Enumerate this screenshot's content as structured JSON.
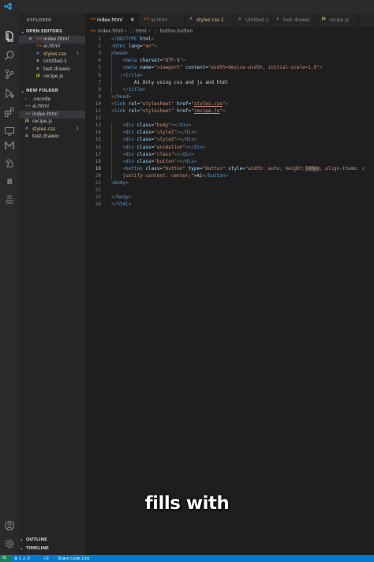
{
  "sidebar": {
    "title": "EXPLORER",
    "open_editors_label": "OPEN EDITORS",
    "open_editors": [
      {
        "name": "index.html",
        "type": "<>",
        "type_color": "#e37933",
        "color": "#cccccc",
        "close": "✕",
        "selected": true
      },
      {
        "name": "ai.html",
        "type": "<>",
        "type_color": "#e37933",
        "color": "#cccccc"
      },
      {
        "name": "styles.css",
        "type": "#",
        "type_color": "#519aba",
        "color": "#e2c08d",
        "badge": "1"
      },
      {
        "name": "Untitled-1",
        "type": "≡",
        "type_color": "#cccccc",
        "color": "#cccccc"
      },
      {
        "name": "test.drawio",
        "type": "≡",
        "type_color": "#cccccc",
        "color": "#cccccc"
      },
      {
        "name": "recipe.js",
        "type": "JS",
        "type_color": "#cbcb41",
        "color": "#cccccc"
      }
    ],
    "folder_label": "NEW FOLDER",
    "folder_items": [
      {
        "name": ".vscode",
        "type": "›",
        "type_color": "#cccccc",
        "color": "#cccccc"
      },
      {
        "name": "ai.html",
        "type": "<>",
        "type_color": "#e37933",
        "color": "#cccccc"
      },
      {
        "name": "index.html",
        "type": "<>",
        "type_color": "#e37933",
        "color": "#cccccc",
        "selected": true
      },
      {
        "name": "recipe.js",
        "type": "JS",
        "type_color": "#cbcb41",
        "color": "#cccccc"
      },
      {
        "name": "styles.css",
        "type": "#",
        "type_color": "#519aba",
        "color": "#e2c08d",
        "badge": "1"
      },
      {
        "name": "test.drawio",
        "type": "≡",
        "type_color": "#cccccc",
        "color": "#cccccc"
      }
    ],
    "outline_label": "OUTLINE",
    "timeline_label": "TIMELINE"
  },
  "activity_icons": [
    "files-icon",
    "search-icon",
    "source-control-icon",
    "run-debug-icon",
    "extensions-icon",
    "remote-explorer-icon",
    "m-extension-icon",
    "chess-knight-icon",
    "b-extension-icon",
    "live-share-icon",
    "account-icon",
    "settings-gear-icon"
  ],
  "tabs": [
    {
      "name": "index.html",
      "type": "<>",
      "type_color": "#e37933",
      "active": true,
      "close": "✕"
    },
    {
      "name": "ai.html",
      "type": "<>",
      "type_color": "#e37933"
    },
    {
      "name": "styles.css 1",
      "type": "#",
      "type_color": "#519aba",
      "color": "#e2c08d"
    },
    {
      "name": "Untitled-1",
      "type": "≡",
      "type_color": "#8a8a8a"
    },
    {
      "name": "test.drawio",
      "type": "≡",
      "type_color": "#8a8a8a"
    },
    {
      "name": "recipe.js",
      "type": "JS",
      "type_color": "#cbcb41"
    }
  ],
  "breadcrumb": {
    "file": "index.html",
    "sep": "›",
    "node1": "html",
    "node2": "button.button"
  },
  "editor": {
    "current_line": 19,
    "lines": [
      {
        "n": "1",
        "code": "<!DOCTYPE html>"
      },
      {
        "n": "2",
        "code": "<html lang=\"en\">"
      },
      {
        "n": "3",
        "code": "<head>"
      },
      {
        "n": "4",
        "code": "    <meta charset=\"UTF-8\">"
      },
      {
        "n": "5",
        "code": "    <meta name=\"viewport\" content=\"width=device-width, initial-scale=1.0\">"
      },
      {
        "n": "6",
        "code": "    <title>"
      },
      {
        "n": "7",
        "code": "        Ai Only using css and js and html"
      },
      {
        "n": "8",
        "code": "    </title>"
      },
      {
        "n": "9",
        "code": "</head>"
      },
      {
        "n": "10",
        "code": "<link rel=\"stylesheet\" href=\"styles.css\">"
      },
      {
        "n": "11",
        "code": "<link rel=\"stylesheet\" href=\"recipe.js\">"
      },
      {
        "n": "12",
        "code": ""
      },
      {
        "n": "13",
        "code": "    <div class=\"body\"></div>"
      },
      {
        "n": "14",
        "code": "    <div class=\"style1\"></div>"
      },
      {
        "n": "15",
        "code": "    <div class=\"style2\"></div>"
      },
      {
        "n": "16",
        "code": "    <div class=\"animation\"></div>"
      },
      {
        "n": "17",
        "code": "    <div class=\"class\"></div>"
      },
      {
        "n": "18",
        "code": "    <div class=\"button\"></div>"
      },
      {
        "n": "19",
        "code": "    <button class=\"button\" type=\"button\" style=\"width: auto; height:100px; align-items: c"
      },
      {
        "n": "20",
        "code": "    justify-content: center;\">Ai</button>"
      },
      {
        "n": "21",
        "code": "<body>"
      },
      {
        "n": "22",
        "code": ""
      },
      {
        "n": "23",
        "code": "</body>"
      },
      {
        "n": "24",
        "code": "</html>"
      }
    ]
  },
  "overlay_caption": "fills with",
  "status": {
    "errors": "⊗ 1 ⚠ 0",
    "ports": "⚡0",
    "share": "Share Code Link"
  },
  "colors": {
    "accent": "#007acc",
    "remote": "#16825d",
    "modified": "#e2c08d",
    "warning_badge": "#cca700"
  }
}
